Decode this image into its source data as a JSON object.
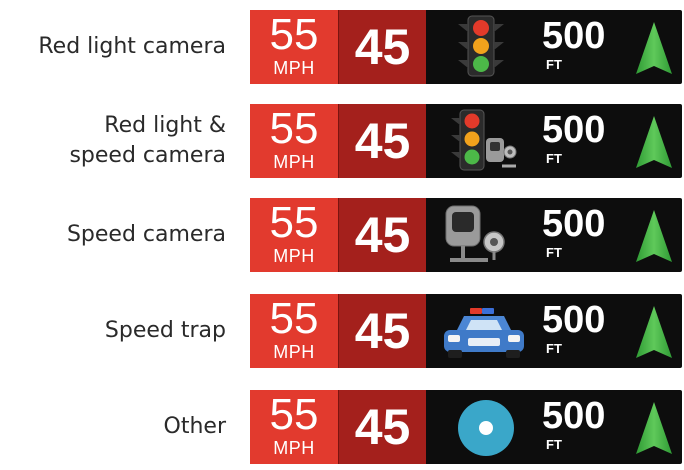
{
  "rows": [
    {
      "label_lines": [
        "Red light camera"
      ],
      "limit": "55",
      "limit_unit": "MPH",
      "speed": "45",
      "icon": "traffic-light-icon",
      "distance": "500",
      "distance_unit": "FT",
      "arrow": "arrow-up-icon"
    },
    {
      "label_lines": [
        "Red light &",
        "speed camera"
      ],
      "limit": "55",
      "limit_unit": "MPH",
      "speed": "45",
      "icon": "traffic-light-speed-camera-icon",
      "distance": "500",
      "distance_unit": "FT",
      "arrow": "arrow-up-icon"
    },
    {
      "label_lines": [
        "Speed camera"
      ],
      "limit": "55",
      "limit_unit": "MPH",
      "speed": "45",
      "icon": "speed-camera-icon",
      "distance": "500",
      "distance_unit": "FT",
      "arrow": "arrow-up-icon"
    },
    {
      "label_lines": [
        "Speed trap"
      ],
      "limit": "55",
      "limit_unit": "MPH",
      "speed": "45",
      "icon": "police-car-icon",
      "distance": "500",
      "distance_unit": "FT",
      "arrow": "arrow-up-icon"
    },
    {
      "label_lines": [
        "Other"
      ],
      "limit": "55",
      "limit_unit": "MPH",
      "speed": "45",
      "icon": "generic-alert-icon",
      "distance": "500",
      "distance_unit": "FT",
      "arrow": "arrow-up-icon"
    }
  ],
  "colors": {
    "limit_bg": "#e23a2e",
    "speed_bg": "#a4201c",
    "banner_bg": "#0d0d0d",
    "arrow": "#3fae3f",
    "alert_blue": "#3aa7c9"
  }
}
